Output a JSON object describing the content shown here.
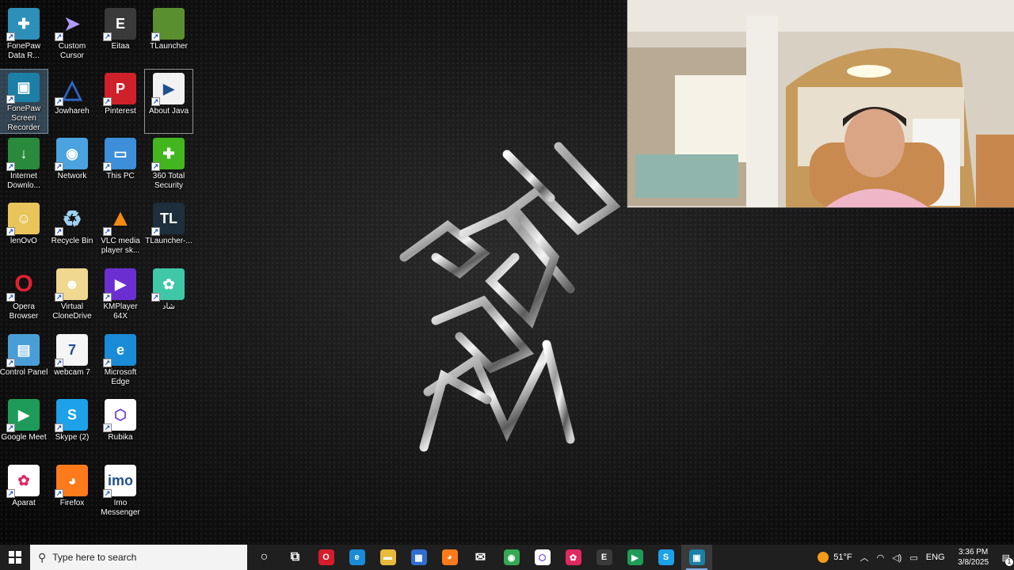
{
  "desktop": {
    "icons": [
      {
        "label": "FonePaw Data R...",
        "icon": "fonepaw-data-icon",
        "color": "#2e8fb8",
        "glyph": "✚"
      },
      {
        "label": "Custom Cursor",
        "icon": "cursor-icon",
        "color": "transparent",
        "glyph": "➤"
      },
      {
        "label": "Eitaa",
        "icon": "eitaa-icon",
        "color": "#3a3a3a",
        "glyph": "E"
      },
      {
        "label": "TLauncher",
        "icon": "tlauncher-grass-icon",
        "color": "#5a8f2f",
        "glyph": ""
      },
      {
        "label": "FonePaw Screen Recorder",
        "icon": "fonepaw-recorder-icon",
        "color": "#1b7fa6",
        "glyph": "▣"
      },
      {
        "label": "Jowhareh",
        "icon": "jowhareh-icon",
        "color": "transparent",
        "glyph": "△"
      },
      {
        "label": "Pinterest",
        "icon": "pinterest-icon",
        "color": "#d0202a",
        "glyph": "P"
      },
      {
        "label": "About Java",
        "icon": "java-icon",
        "color": "#f2f2f2",
        "glyph": "▶"
      },
      {
        "label": "Internet Downlo...",
        "icon": "idm-icon",
        "color": "#2a8a3c",
        "glyph": "↓"
      },
      {
        "label": "Network",
        "icon": "network-icon",
        "color": "#4aa3df",
        "glyph": "◉"
      },
      {
        "label": "This PC",
        "icon": "computer-icon",
        "color": "#3c8fd8",
        "glyph": "▭"
      },
      {
        "label": "360 Total Security",
        "icon": "security-360-icon",
        "color": "#43b61f",
        "glyph": "✚"
      },
      {
        "label": "lenOvO",
        "icon": "user-folder-icon",
        "color": "#e8c45a",
        "glyph": "☺"
      },
      {
        "label": "Recycle Bin",
        "icon": "recycle-bin-icon",
        "color": "transparent",
        "glyph": "♻"
      },
      {
        "label": "VLC media player sk...",
        "icon": "vlc-icon",
        "color": "transparent",
        "glyph": "▲"
      },
      {
        "label": "TLauncher-...",
        "icon": "tlauncher-icon",
        "color": "#1d2f3c",
        "glyph": "TL"
      },
      {
        "label": "Opera Browser",
        "icon": "opera-icon",
        "color": "transparent",
        "glyph": "O"
      },
      {
        "label": "Virtual CloneDrive",
        "icon": "clonedrive-sheep-icon",
        "color": "#f0d890",
        "glyph": "☻"
      },
      {
        "label": "KMPlayer 64X",
        "icon": "kmplayer-icon",
        "color": "#6b2fd1",
        "glyph": "▶"
      },
      {
        "label": "شاد",
        "icon": "shad-icon",
        "color": "#3fc8a8",
        "glyph": "✿"
      },
      {
        "label": "Control Panel",
        "icon": "control-panel-icon",
        "color": "#4a9ed8",
        "glyph": "▤"
      },
      {
        "label": "webcam 7",
        "icon": "webcam-icon",
        "color": "#f5f5f5",
        "glyph": "7"
      },
      {
        "label": "Microsoft Edge",
        "icon": "edge-icon",
        "color": "#1a8bd6",
        "glyph": "e"
      },
      {
        "label": "",
        "icon": "",
        "color": "",
        "glyph": ""
      },
      {
        "label": "Google Meet",
        "icon": "google-meet-icon",
        "color": "#1e9b58",
        "glyph": "▶"
      },
      {
        "label": "Skype (2)",
        "icon": "skype-icon",
        "color": "#1da1e8",
        "glyph": "S"
      },
      {
        "label": "Rubika",
        "icon": "rubika-icon",
        "color": "#ffffff",
        "glyph": "⬡"
      },
      {
        "label": "",
        "icon": "",
        "color": "",
        "glyph": ""
      },
      {
        "label": "Aparat",
        "icon": "aparat-icon",
        "color": "#ffffff",
        "glyph": "✿"
      },
      {
        "label": "Firefox",
        "icon": "firefox-icon",
        "color": "#ff7a1a",
        "glyph": "◕"
      },
      {
        "label": "Imo Messenger",
        "icon": "imo-icon",
        "color": "#ffffff",
        "glyph": "imo"
      }
    ]
  },
  "taskbar": {
    "search_placeholder": "Type here to search",
    "apps": [
      {
        "name": "cortana-icon",
        "glyph": "○",
        "color": "transparent"
      },
      {
        "name": "task-view-icon",
        "glyph": "⧉",
        "color": "transparent"
      },
      {
        "name": "opera-icon",
        "glyph": "O",
        "color": "#d61c2b"
      },
      {
        "name": "edge-icon",
        "glyph": "e",
        "color": "#1a8bd6"
      },
      {
        "name": "file-explorer-icon",
        "glyph": "▬",
        "color": "#e8b93b"
      },
      {
        "name": "microsoft-store-icon",
        "glyph": "▦",
        "color": "#2f6fd0"
      },
      {
        "name": "firefox-icon",
        "glyph": "◕",
        "color": "#ff7a1a"
      },
      {
        "name": "mail-icon",
        "glyph": "✉",
        "color": "transparent"
      },
      {
        "name": "chrome-icon",
        "glyph": "◉",
        "color": "#34a853"
      },
      {
        "name": "rubika-icon",
        "glyph": "⬡",
        "color": "#ffffff"
      },
      {
        "name": "aparat-icon",
        "glyph": "✿",
        "color": "#e02861"
      },
      {
        "name": "eitaa-icon",
        "glyph": "E",
        "color": "#3a3a3a"
      },
      {
        "name": "google-meet-icon",
        "glyph": "▶",
        "color": "#1e9b58"
      },
      {
        "name": "skype-icon",
        "glyph": "S",
        "color": "#1da1e8"
      },
      {
        "name": "fonepaw-recorder-icon",
        "glyph": "▣",
        "color": "#1b7fa6"
      }
    ],
    "weather": "51°F",
    "language": "ENG",
    "time": "3:36 PM",
    "date": "3/8/2025",
    "notification_count": "1"
  }
}
